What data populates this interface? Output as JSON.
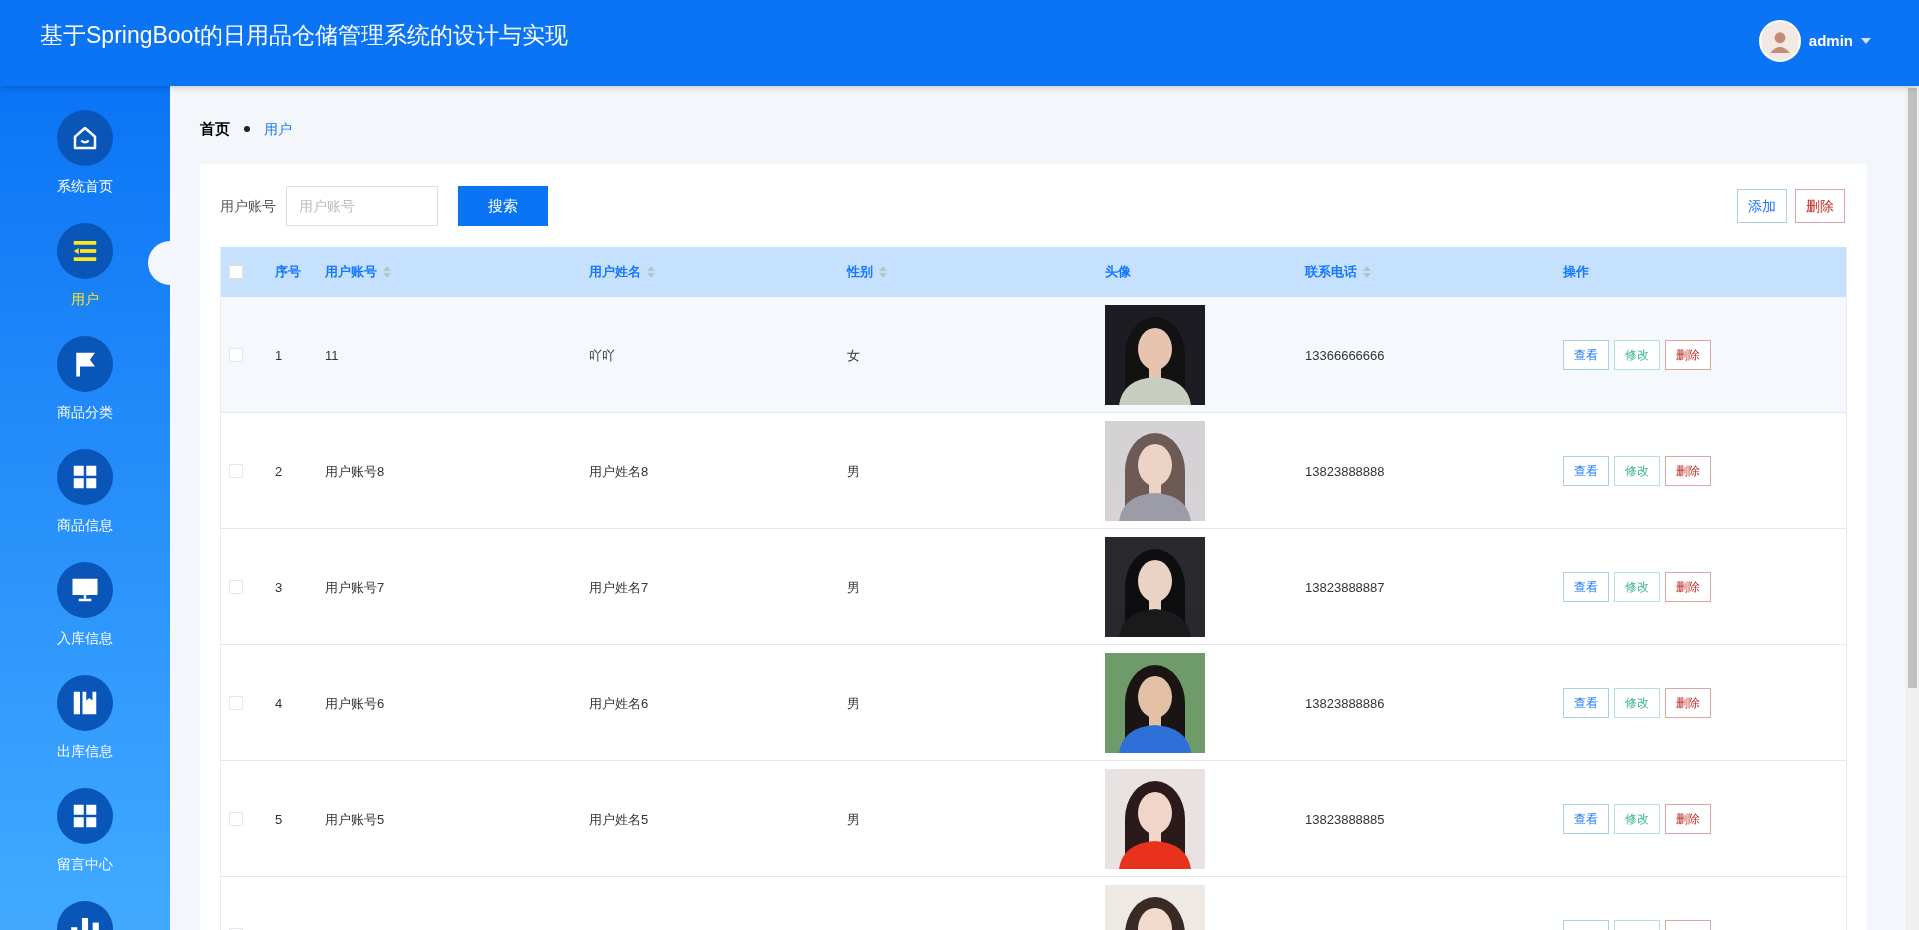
{
  "header": {
    "title": "基于SpringBoot的日用品仓储管理系统的设计与实现",
    "user": "admin"
  },
  "sidebar": {
    "items": [
      {
        "label": "系统首页",
        "selected": false
      },
      {
        "label": "用户",
        "selected": true
      },
      {
        "label": "商品分类",
        "selected": false
      },
      {
        "label": "商品信息",
        "selected": false
      },
      {
        "label": "入库信息",
        "selected": false
      },
      {
        "label": "出库信息",
        "selected": false
      },
      {
        "label": "留言中心",
        "selected": false
      },
      {
        "selected": false
      }
    ]
  },
  "breadcrumb": [
    "首页",
    "用户"
  ],
  "search": {
    "label": "用户账号",
    "placeholder": "用户账号",
    "button": "搜索"
  },
  "actions": [
    {
      "label": "添加",
      "kind": "add"
    },
    {
      "label": "删除",
      "kind": "delete"
    }
  ],
  "table": {
    "select_all": {
      "checked": false
    },
    "columns": [
      {
        "label": "序号",
        "sortable": false
      },
      {
        "label": "用户账号",
        "sortable": true
      },
      {
        "label": "用户姓名",
        "sortable": true
      },
      {
        "label": "性别",
        "sortable": true
      },
      {
        "label": "头像",
        "sortable": false
      },
      {
        "label": "联系电话",
        "sortable": true
      },
      {
        "label": "操作",
        "sortable": false
      }
    ],
    "rows": [
      {
        "checked": false,
        "index": "1",
        "account": "11",
        "name": "吖吖",
        "gender": "女",
        "phone": "13366666666",
        "actions": [
          {
            "label": "查看",
            "kind": "view"
          },
          {
            "label": "修改",
            "kind": "edit"
          },
          {
            "label": "删除",
            "kind": "delete"
          }
        ]
      },
      {
        "checked": false,
        "index": "2",
        "account": "用户账号8",
        "name": "用户姓名8",
        "gender": "男",
        "phone": "13823888888",
        "actions": [
          {
            "label": "查看",
            "kind": "view"
          },
          {
            "label": "修改",
            "kind": "edit"
          },
          {
            "label": "删除",
            "kind": "delete"
          }
        ]
      },
      {
        "checked": false,
        "index": "3",
        "account": "用户账号7",
        "name": "用户姓名7",
        "gender": "男",
        "phone": "13823888887",
        "actions": [
          {
            "label": "查看",
            "kind": "view"
          },
          {
            "label": "修改",
            "kind": "edit"
          },
          {
            "label": "删除",
            "kind": "delete"
          }
        ]
      },
      {
        "checked": false,
        "index": "4",
        "account": "用户账号6",
        "name": "用户姓名6",
        "gender": "男",
        "phone": "13823888886",
        "actions": [
          {
            "label": "查看",
            "kind": "view"
          },
          {
            "label": "修改",
            "kind": "edit"
          },
          {
            "label": "删除",
            "kind": "delete"
          }
        ]
      },
      {
        "checked": false,
        "index": "5",
        "account": "用户账号5",
        "name": "用户姓名5",
        "gender": "男",
        "phone": "13823888885",
        "actions": [
          {
            "label": "查看",
            "kind": "view"
          },
          {
            "label": "修改",
            "kind": "edit"
          },
          {
            "label": "删除",
            "kind": "delete"
          }
        ]
      },
      {
        "checked": false,
        "actions": [
          {
            "kind": "view"
          },
          {
            "kind": "edit"
          },
          {
            "kind": "delete"
          }
        ]
      }
    ]
  }
}
